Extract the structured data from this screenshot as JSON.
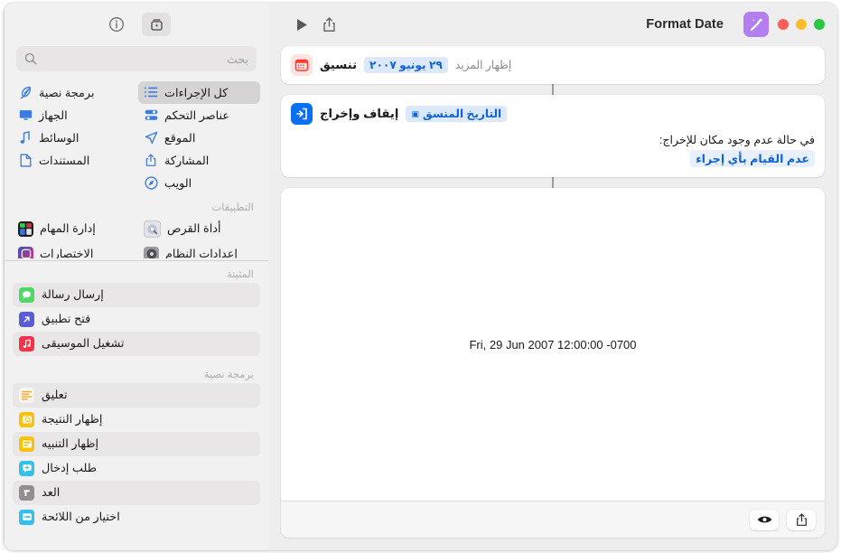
{
  "window": {
    "title": "Format Date",
    "traffic_lights": [
      {
        "name": "close-button",
        "color": "#28c840"
      },
      {
        "name": "minimize-button",
        "color": "#febc2e"
      },
      {
        "name": "zoom-button",
        "color": "#ff5f57"
      }
    ],
    "doc_badge_color": "#b37ef0"
  },
  "toolbar": {
    "run_label": "تشغيل",
    "share_label": "مشاركة",
    "info_label": "معلومات",
    "add_action_label": "إضافة إجراء"
  },
  "search": {
    "placeholder": "بحث",
    "value": ""
  },
  "library": {
    "items": [
      {
        "label": "كل الإجراءات",
        "icon": "list-icon",
        "selected": true
      },
      {
        "label": "برمجة نصية",
        "icon": "feather-icon",
        "selected": false
      },
      {
        "label": "عناصر التحكم",
        "icon": "sliders-icon",
        "selected": false
      },
      {
        "label": "الجهاز",
        "icon": "display-icon",
        "selected": false
      },
      {
        "label": "الموقع",
        "icon": "location-icon",
        "selected": false
      },
      {
        "label": "الوسائط",
        "icon": "music-note-icon",
        "selected": false
      },
      {
        "label": "المشاركة",
        "icon": "share-icon",
        "selected": false
      },
      {
        "label": "المستندات",
        "icon": "document-icon",
        "selected": false
      },
      {
        "label": "الويب",
        "icon": "compass-icon",
        "selected": false
      }
    ]
  },
  "applications": {
    "header": "التطبيقات",
    "items": [
      {
        "label": "أداة القرص",
        "icon": "disk-utility-icon",
        "color": "#d8d8dc"
      },
      {
        "label": "إدارة المهام",
        "icon": "mission-control-icon",
        "color": "#2b2b33"
      },
      {
        "label": "إعدادات النظام",
        "icon": "system-settings-icon",
        "color": "#8e8e93"
      },
      {
        "label": "الاختصارات",
        "icon": "shortcuts-icon",
        "color": "#d6306c"
      }
    ]
  },
  "pinned": {
    "header": "المثبتة",
    "items": [
      {
        "label": "إرسال رسالة",
        "icon": "messages-icon",
        "color": "#4cd964",
        "alt": true
      },
      {
        "label": "فتح تطبيق",
        "icon": "open-app-icon",
        "color": "#5b5bd6",
        "alt": false
      },
      {
        "label": "تشغيل الموسيقى",
        "icon": "music-icon",
        "color": "#fa2f48",
        "alt": true
      }
    ]
  },
  "scripting": {
    "header": "برمجة نصية",
    "items": [
      {
        "label": "تعليق",
        "icon": "comment-icon",
        "color": "#f5f3f0",
        "alt": true
      },
      {
        "label": "إظهار النتيجة",
        "icon": "show-result-icon",
        "color": "#ffc107",
        "alt": false
      },
      {
        "label": "إظهار التنبيه",
        "icon": "show-alert-icon",
        "color": "#ffc107",
        "alt": true
      },
      {
        "label": "طلب إدخال",
        "icon": "ask-input-icon",
        "color": "#34c0ee",
        "alt": false
      },
      {
        "label": "العد",
        "icon": "count-icon",
        "color": "#8e8e93",
        "alt": true
      },
      {
        "label": "اختيار من اللائحة",
        "icon": "choose-from-list-icon",
        "color": "#34c0ee",
        "alt": false
      }
    ]
  },
  "workflow": {
    "actions": [
      {
        "title": "تنسيق",
        "token": "٢٩ يونيو ٢٠٠٧",
        "show_more": "إظهار المزيد",
        "icon": "calendar-icon",
        "icon_bg": "#ffe3e0",
        "icon_fg": "#ff3b30"
      },
      {
        "title": "إيقاف وإخراج",
        "token": "التاريخ المنسق",
        "body_label": "في حالة عدم وجود مكان للإخراج:",
        "body_link": "عدم القيام بأي إجراء",
        "icon": "stop-output-icon",
        "icon_bg": "#0a6ff0",
        "icon_fg": "#ffffff"
      }
    ]
  },
  "results": {
    "text": "Fri, 29 Jun 2007 12:00:00 -0700",
    "footer_buttons": [
      {
        "name": "share-result-button",
        "icon": "share-icon"
      },
      {
        "name": "quicklook-result-button",
        "icon": "eye-icon"
      }
    ]
  },
  "colors": {
    "accent_blue": "#1063d6",
    "token_bg": "#dce8fb",
    "card_bg": "#ffffff",
    "window_bg": "#efeeee",
    "sidebar_bg": "#f2f1f1"
  }
}
